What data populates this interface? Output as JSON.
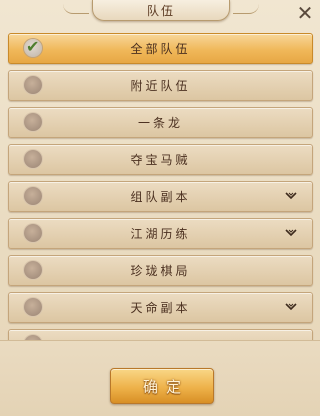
{
  "header": {
    "title": "队伍"
  },
  "close": {
    "icon": "close-x-icon",
    "glyph": "✕"
  },
  "list": {
    "items": [
      {
        "label": "全部队伍",
        "selected": true,
        "expandable": false
      },
      {
        "label": "附近队伍",
        "selected": false,
        "expandable": false
      },
      {
        "label": "一条龙",
        "selected": false,
        "expandable": false
      },
      {
        "label": "夺宝马贼",
        "selected": false,
        "expandable": false
      },
      {
        "label": "组队副本",
        "selected": false,
        "expandable": true
      },
      {
        "label": "江湖历练",
        "selected": false,
        "expandable": true
      },
      {
        "label": "珍珑棋局",
        "selected": false,
        "expandable": false
      },
      {
        "label": "天命副本",
        "selected": false,
        "expandable": true
      },
      {
        "label": "",
        "selected": false,
        "expandable": false
      }
    ]
  },
  "footer": {
    "confirm_label": "确定"
  },
  "colors": {
    "selected_row": "#f0b85a",
    "row": "#dcc6a2",
    "check": "#4f7f2f"
  }
}
